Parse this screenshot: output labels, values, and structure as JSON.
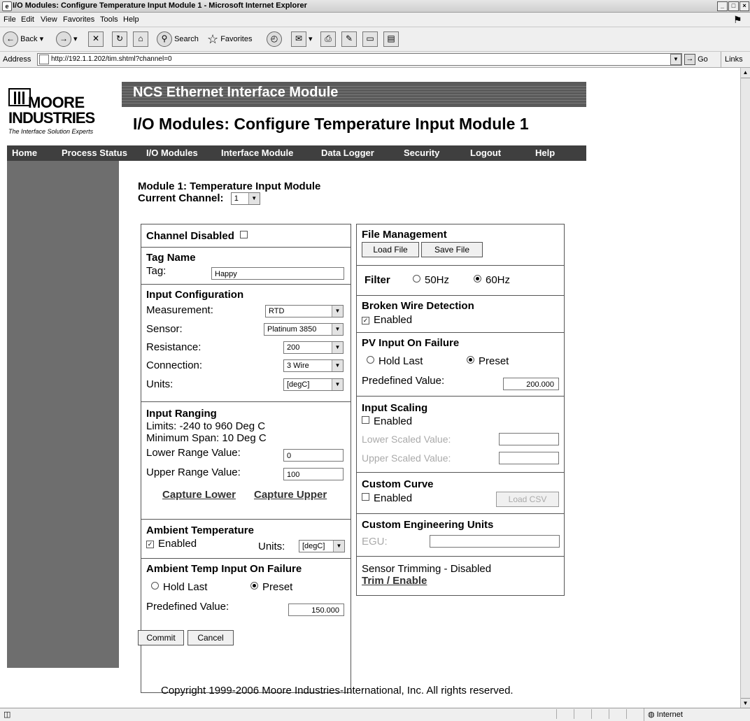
{
  "browser": {
    "title": "I/O Modules: Configure Temperature Input Module 1 - Microsoft Internet Explorer",
    "menu": [
      "File",
      "Edit",
      "View",
      "Favorites",
      "Tools",
      "Help"
    ],
    "toolbar": {
      "back": "Back",
      "search": "Search",
      "favorites": "Favorites"
    },
    "address_label": "Address",
    "url": "http://192.1.1.202/tim.shtml?channel=0",
    "go": "Go",
    "links": "Links",
    "zone": "Internet"
  },
  "header": {
    "logo_line1": "MOORE",
    "logo_line2": "INDUSTRIES",
    "logo_tagline": "The Interface Solution Experts",
    "app_title": "NCS Ethernet Interface Module",
    "page_title": "I/O Modules: Configure Temperature Input Module 1"
  },
  "nav": [
    "Home",
    "Process Status",
    "I/O Modules",
    "Interface Module",
    "Data Logger",
    "Security",
    "Logout",
    "Help"
  ],
  "module": {
    "title": "Module 1: Temperature Input Module",
    "channel_label": "Current Channel:",
    "channel_value": "1"
  },
  "left": {
    "channel_disabled": "Channel Disabled",
    "tag_name": "Tag Name",
    "tag_label": "Tag:",
    "tag_value": "Happy",
    "input_config": "Input Configuration",
    "measurement_label": "Measurement:",
    "measurement_value": "RTD",
    "sensor_label": "Sensor:",
    "sensor_value": "Platinum 3850",
    "resistance_label": "Resistance:",
    "resistance_value": "200",
    "connection_label": "Connection:",
    "connection_value": "3 Wire",
    "units_label": "Units:",
    "units_value": "[degC]",
    "input_ranging": "Input Ranging",
    "limits": "Limits: -240 to 960 Deg C",
    "min_span": "Minimum Span: 10 Deg C",
    "lower_range_label": "Lower Range Value:",
    "lower_range_value": "0",
    "upper_range_label": "Upper Range Value:",
    "upper_range_value": "100",
    "capture_lower": "Capture Lower",
    "capture_upper": "Capture Upper",
    "ambient": "Ambient Temperature",
    "ambient_enabled": "Enabled",
    "ambient_units_label": "Units:",
    "ambient_units_value": "[degC]",
    "ambient_failure": "Ambient Temp Input On Failure",
    "hold_last": "Hold Last",
    "preset": "Preset",
    "predefined_label": "Predefined Value:",
    "predefined_value": "150.000"
  },
  "right": {
    "file_mgmt": "File Management",
    "load_file": "Load File",
    "save_file": "Save File",
    "filter": "Filter",
    "hz50": "50Hz",
    "hz60": "60Hz",
    "broken_wire": "Broken Wire Detection",
    "enabled": "Enabled",
    "pv_failure": "PV Input On Failure",
    "hold_last": "Hold Last",
    "preset": "Preset",
    "predefined_label": "Predefined Value:",
    "predefined_value": "200.000",
    "input_scaling": "Input Scaling",
    "lower_scaled": "Lower Scaled Value:",
    "upper_scaled": "Upper Scaled Value:",
    "custom_curve": "Custom Curve",
    "load_csv": "Load CSV",
    "custom_eu": "Custom Engineering Units",
    "egu": "EGU:",
    "trimming": "Sensor Trimming -  Disabled",
    "trim_link": "Trim / Enable"
  },
  "actions": {
    "commit": "Commit",
    "cancel": "Cancel"
  },
  "copyright": "Copyright 1999-2006 Moore Industries-International, Inc. All rights reserved."
}
